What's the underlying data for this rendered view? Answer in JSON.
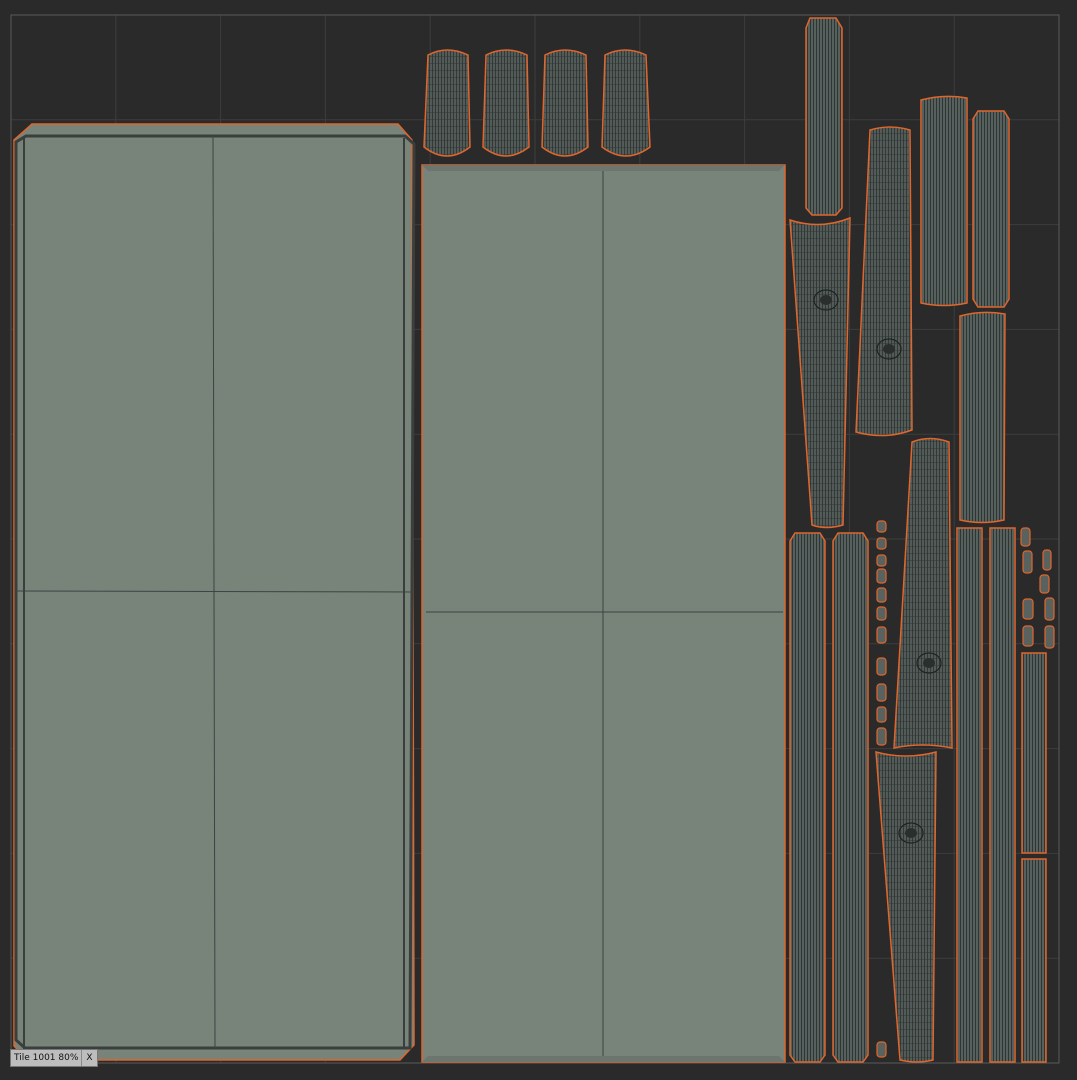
{
  "viewport": {
    "colors": {
      "background": "#2a2a2a",
      "grid": "#3d3d3d",
      "tile_border": "#5a5a5a",
      "shell_fill": "#78837a",
      "shell_border": "#e0662c",
      "wire": "#26292a",
      "strip_fill": "#4f5755"
    }
  },
  "status_bar": {
    "tile_label": "Tile 1001 80%",
    "close_label": "X"
  }
}
